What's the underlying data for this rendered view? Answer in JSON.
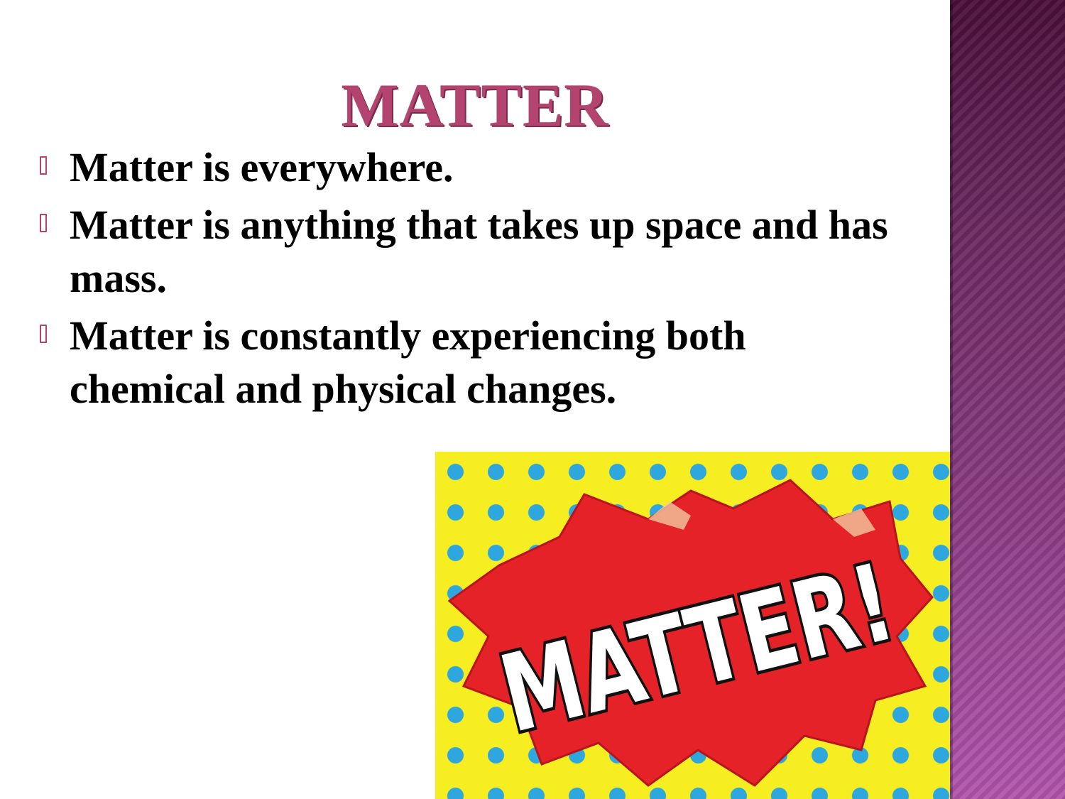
{
  "slide": {
    "title": "MATTER",
    "bullets": [
      "Matter is everywhere.",
      "Matter is anything that takes up space and has mass.",
      "Matter is constantly experiencing both chemical and physical changes."
    ]
  },
  "image": {
    "icon": "comic-burst-matter-image",
    "lettering": "MATTER!",
    "colors": {
      "background": "#f7ee22",
      "dots": "#2ea7df",
      "burst": "#e42228",
      "letters": "#ffffff",
      "outline": "#111111"
    }
  },
  "theme": {
    "title_color": "#b2446f",
    "side_band": "#8b3d84"
  }
}
